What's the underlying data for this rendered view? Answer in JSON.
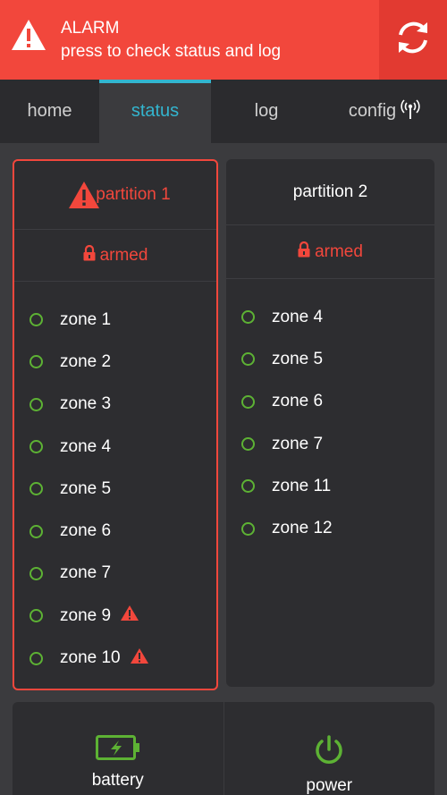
{
  "alarm": {
    "title": "ALARM",
    "message": "press to check status and log",
    "color": "#f2473c"
  },
  "tabs": [
    {
      "label": "home",
      "active": false
    },
    {
      "label": "status",
      "active": true
    },
    {
      "label": "log",
      "active": false
    },
    {
      "label": "config",
      "active": false,
      "icon": "signal-tower-icon"
    }
  ],
  "accent": "#33b5cf",
  "partitions": [
    {
      "name": "partition 1",
      "alarm": true,
      "state": "armed",
      "zones": [
        {
          "label": "zone 1",
          "warning": false
        },
        {
          "label": "zone 2",
          "warning": false
        },
        {
          "label": "zone 3",
          "warning": false
        },
        {
          "label": "zone 4",
          "warning": false
        },
        {
          "label": "zone 5",
          "warning": false
        },
        {
          "label": "zone 6",
          "warning": false
        },
        {
          "label": "zone 7",
          "warning": false
        },
        {
          "label": "zone 9",
          "warning": true
        },
        {
          "label": "zone 10",
          "warning": true
        }
      ]
    },
    {
      "name": "partition 2",
      "alarm": false,
      "state": "armed",
      "zones": [
        {
          "label": "zone 4",
          "warning": false
        },
        {
          "label": "zone 5",
          "warning": false
        },
        {
          "label": "zone 6",
          "warning": false
        },
        {
          "label": "zone 7",
          "warning": false
        },
        {
          "label": "zone 11",
          "warning": false
        },
        {
          "label": "zone 12",
          "warning": false
        }
      ]
    }
  ],
  "bottom": {
    "battery_label": "battery",
    "power_label": "power",
    "ok_color": "#5db234"
  }
}
